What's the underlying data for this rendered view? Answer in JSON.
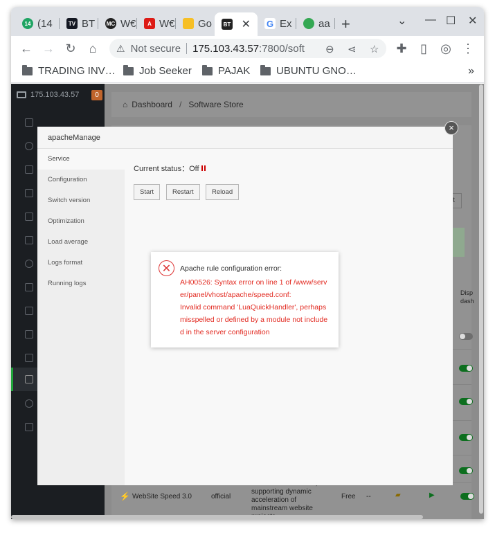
{
  "tabs": [
    {
      "label": "(14",
      "icon": "badge-14-icon",
      "color": "#1fa463"
    },
    {
      "label": "BT",
      "icon": "tradingview-icon",
      "color": "#131722"
    },
    {
      "label": "W€",
      "icon": "mc-icon",
      "color": "#222222"
    },
    {
      "label": "W€",
      "icon": "angular-icon",
      "color": "#dd1b16"
    },
    {
      "label": "Go",
      "icon": "keep-icon",
      "color": "#f6bf26"
    },
    {
      "label": "BT",
      "icon": "bt-icon",
      "color": "#222222",
      "active": true
    },
    {
      "label": "Ex",
      "icon": "google-icon",
      "color": "#4285f4"
    },
    {
      "label": "aa",
      "icon": "frog-icon",
      "color": "#34a853"
    }
  ],
  "toolbar": {
    "not_secure": "Not secure",
    "url_host": "175.103.43.57",
    "url_rest": ":7800/soft"
  },
  "bookmarks": [
    "TRADING INV…",
    "Job Seeker",
    "PAJAK",
    "UBUNTU GNO…"
  ],
  "panel": {
    "host": "175.103.43.57",
    "badge": "0",
    "breadcrumb": {
      "home": "Dashboard",
      "current": "Software Store"
    },
    "peek_button": "st",
    "peek_column": "s",
    "peek_col2": "Disp dash",
    "bottom_row": {
      "name": "WebSite Speed 3.0",
      "developer": "official",
      "desc": "Website acceleration, supporting dynamic acceleration of mainstream website projects",
      "price": "Free",
      "expire": "--"
    }
  },
  "modal": {
    "title": "apacheManage",
    "menu": [
      "Service",
      "Configuration",
      "Switch version",
      "Optimization",
      "Load average",
      "Logs format",
      "Running logs"
    ],
    "status_label": "Current status：Off",
    "buttons": {
      "start": "Start",
      "restart": "Restart",
      "reload": "Reload"
    }
  },
  "error": {
    "title": "Apache rule configuration error:",
    "line1": "AH00526: Syntax error on line 1 of /www/server/panel/vhost/apache/speed.conf:",
    "line2": "Invalid command 'LuaQuickHandler', perhaps misspelled or defined by a module not included in the server configuration"
  }
}
